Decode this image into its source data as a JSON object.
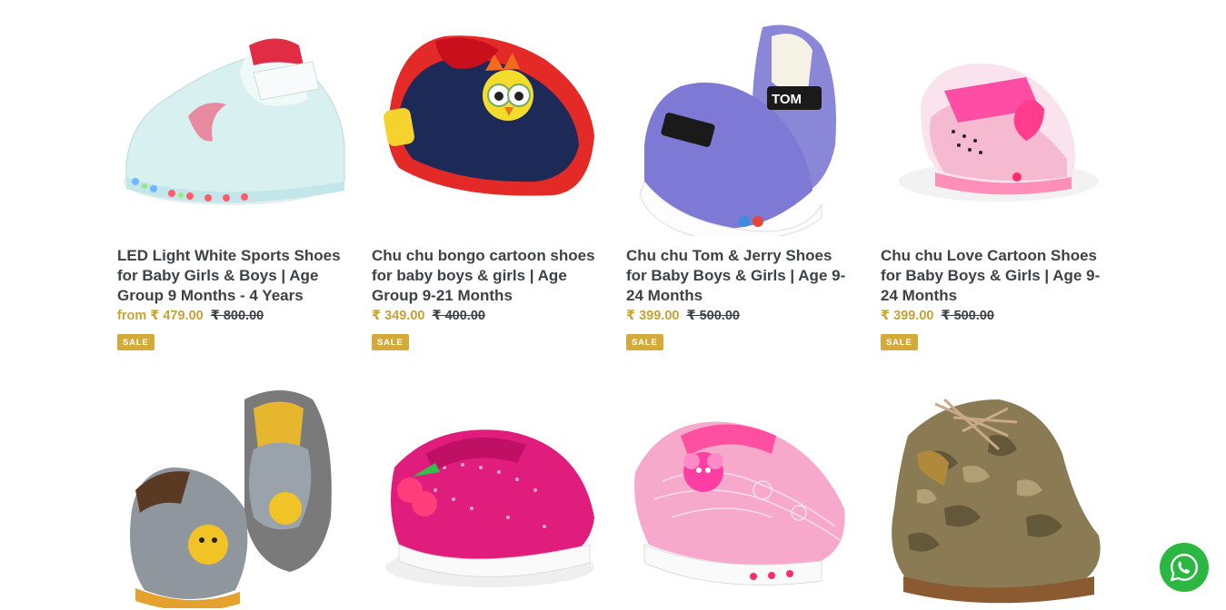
{
  "products": [
    {
      "title": "LED Light White Sports Shoes for Baby Girls & Boys | Age Group 9 Months - 4 Years",
      "sale_price": "from ₹ 479.00",
      "regular_price": "₹ 800.00",
      "badge": "SALE",
      "image_icon": "white-led-sports-shoe"
    },
    {
      "title": "Chu chu bongo cartoon shoes for baby boys & girls | Age Group 9-21 Months",
      "sale_price": "₹ 349.00",
      "regular_price": "₹ 400.00",
      "badge": "SALE",
      "image_icon": "navy-red-owl-shoe"
    },
    {
      "title": "Chu chu Tom & Jerry Shoes for Baby Boys & Girls | Age 9-24 Months",
      "sale_price": "₹ 399.00",
      "regular_price": "₹ 500.00",
      "badge": "SALE",
      "image_icon": "purple-tom-jerry-shoe"
    },
    {
      "title": "Chu chu Love Cartoon Shoes for Baby Boys & Girls | Age 9-24 Months",
      "sale_price": "₹ 399.00",
      "regular_price": "₹ 500.00",
      "badge": "SALE",
      "image_icon": "pink-love-shoe"
    },
    {
      "image_icon": "grey-bear-shoes"
    },
    {
      "image_icon": "pink-dotted-cherry-shoe"
    },
    {
      "image_icon": "pink-lace-butterfly-shoe"
    },
    {
      "image_icon": "camo-lace-up-boot"
    }
  ],
  "whatsapp": {
    "icon": "whatsapp-icon",
    "color": "#2bb741"
  },
  "colors": {
    "sale": "#c8a234",
    "badge": "#d4ab3b",
    "text": "#3d4246"
  }
}
